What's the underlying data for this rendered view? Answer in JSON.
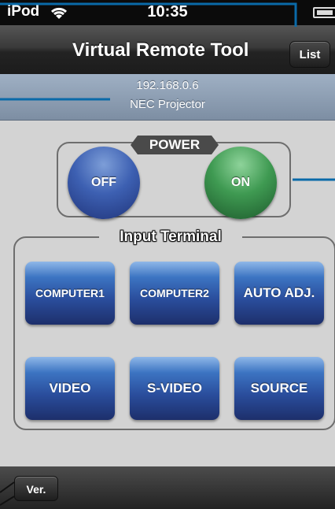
{
  "status_bar": {
    "carrier": "iPod",
    "time": "10:35"
  },
  "navbar": {
    "title": "Virtual Remote Tool",
    "list_label": "List"
  },
  "device": {
    "ip": "192.168.0.6",
    "name": "NEC Projector"
  },
  "power": {
    "label": "POWER",
    "off_label": "OFF",
    "on_label": "ON"
  },
  "input_terminal": {
    "label": "Input Terminal",
    "buttons": [
      "COMPUTER1",
      "COMPUTER2",
      "AUTO ADJ.",
      "VIDEO",
      "S-VIDEO",
      "SOURCE"
    ]
  },
  "bottom_bar": {
    "ver_label": "Ver."
  },
  "colors": {
    "callout": "#0a6aa8",
    "power_off": "#2f4fa0",
    "power_on": "#2f8a45",
    "terminal_button": "#2a4d9c",
    "device_header": "#8a9bb0"
  },
  "icons": [
    "wifi-icon",
    "battery-icon"
  ]
}
